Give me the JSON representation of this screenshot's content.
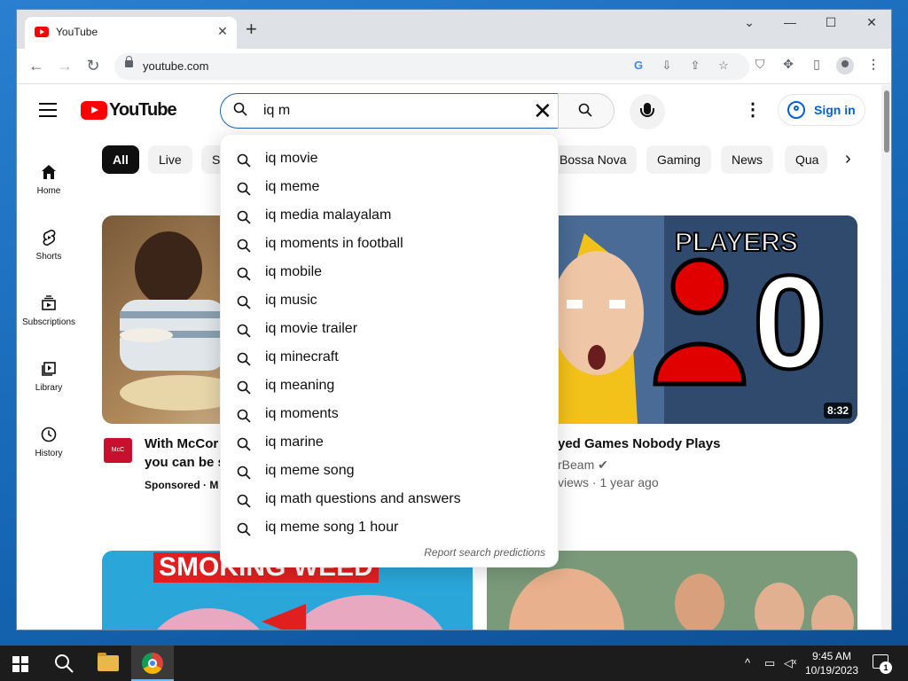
{
  "browser": {
    "tab_title": "YouTube",
    "tab_close": "✕",
    "new_tab": "+",
    "url": "youtube.com",
    "controls": {
      "minimize": "—",
      "maximize": "☐",
      "close": "✕",
      "dropdown": "⌄"
    }
  },
  "youtube": {
    "logo_text": "YouTube",
    "search": {
      "query": "iq m",
      "clear": "✕"
    },
    "sign_in": "Sign in",
    "more": "⋮",
    "guide": [
      {
        "label": "Home",
        "icon": "home-icon"
      },
      {
        "label": "Shorts",
        "icon": "shorts-icon"
      },
      {
        "label": "Subscriptions",
        "icon": "subscriptions-icon"
      },
      {
        "label": "Library",
        "icon": "library-icon"
      },
      {
        "label": "History",
        "icon": "history-icon"
      }
    ],
    "chips": [
      "All",
      "Live",
      "S",
      "Bossa Nova",
      "Gaming",
      "News",
      "Qua"
    ],
    "chip_next": "›",
    "suggestions": [
      "iq movie",
      "iq meme",
      "iq media malayalam",
      "iq moments in football",
      "iq mobile",
      "iq music",
      "iq movie trailer",
      "iq minecraft",
      "iq meaning",
      "iq moments",
      "iq marine",
      "iq meme song",
      "iq math questions and answers",
      "iq meme song 1 hour"
    ],
    "report_link": "Report search predictions",
    "videos": [
      {
        "title_line1": "With McCor",
        "title_line2": "you can be s",
        "meta": "Sponsored · M"
      },
      {
        "title": "yed Games Nobody Plays",
        "channel": "rBeam ✔",
        "meta": "views · 1 year ago",
        "duration": "8:32",
        "thumb_text": "PLAYERS",
        "thumb_big": "0"
      },
      {
        "thumb_text": "SMOKING WEED"
      },
      {}
    ]
  },
  "taskbar": {
    "time": "9:45 AM",
    "date": "10/19/2023",
    "notifications": "1"
  },
  "colors": {
    "accent": "#065fd4",
    "youtube_red": "#ff0000",
    "search_border": "#1c62b9"
  }
}
